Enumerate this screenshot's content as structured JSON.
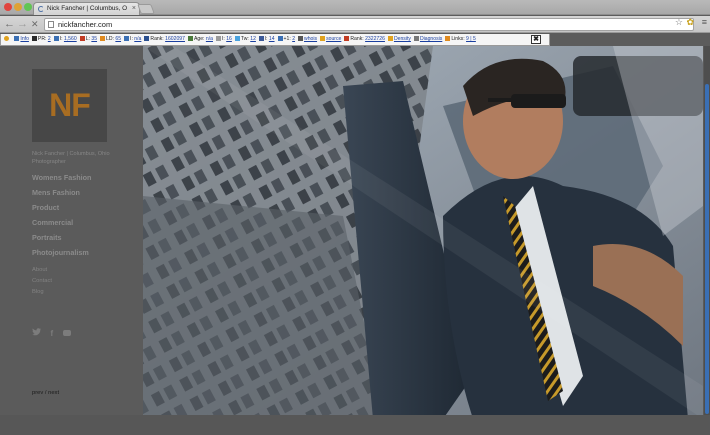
{
  "browser": {
    "tab_title": "Nick Fancher | Columbus, O",
    "tab_close": "×",
    "back": "←",
    "forward": "→",
    "stop": "✕",
    "url": "nickfancher.com",
    "star": "☆",
    "menu": "≡"
  },
  "seobar": {
    "items": [
      {
        "label": "Info",
        "link": true,
        "color": "#3a6fb4"
      },
      {
        "label": "PR: ",
        "link": false,
        "value": "2",
        "color": "#2a2a2a"
      },
      {
        "label": "I: ",
        "link": false,
        "value": "1,560",
        "color": "#3a6fb4"
      },
      {
        "label": "L: ",
        "link": false,
        "value": "35",
        "color": "#c23b22"
      },
      {
        "label": "LD: ",
        "link": false,
        "value": "65",
        "color": "#e08a1e"
      },
      {
        "label": "I: ",
        "link": false,
        "value": "n/a",
        "color": "#3a6fb4"
      },
      {
        "label": "Rank: ",
        "link": false,
        "value": "1602097",
        "color": "#2a4f8f"
      },
      {
        "label": "Age: ",
        "link": false,
        "value": "n/a",
        "color": "#4a7a3a"
      },
      {
        "label": "I: ",
        "link": false,
        "value": "16",
        "color": "#9a9a9a"
      },
      {
        "label": "Tw: ",
        "link": false,
        "value": "12",
        "color": "#4aa3df"
      },
      {
        "label": "l: ",
        "link": false,
        "value": "14",
        "color": "#3b5998"
      },
      {
        "label": "+1: ",
        "link": false,
        "value": "2",
        "color": "#3a6fb4"
      },
      {
        "label": "whois",
        "link": true,
        "color": "#555555"
      },
      {
        "label": "source",
        "link": true,
        "color": "#e0a21e"
      },
      {
        "label": "Rank: ",
        "link": false,
        "value": "2322726",
        "color": "#c23b22"
      },
      {
        "label": "Density",
        "link": true,
        "color": "#e0a21e"
      },
      {
        "label": "Diagnosis",
        "link": true,
        "color": "#777777"
      },
      {
        "label": "Links: ",
        "link": false,
        "value": "9 | 5",
        "color": "#e08a1e"
      }
    ],
    "close": "✖"
  },
  "site": {
    "logo_text": "NF",
    "tagline": "Nick Fancher | Columbus, Ohio Photographer",
    "nav_main": [
      "Womens Fashion",
      "Mens Fashion",
      "Product",
      "Commercial",
      "Portraits",
      "Photojournalism"
    ],
    "nav_sub": [
      "About",
      "Contact",
      "Blog"
    ],
    "social": {
      "twitter": "🐦",
      "facebook": "f"
    },
    "prevnext": "prev / next"
  },
  "colors": {
    "page_bg": "#5b5b5b",
    "logo_accent": "#a86d22",
    "scroll_accent": "#3a6fb4"
  }
}
